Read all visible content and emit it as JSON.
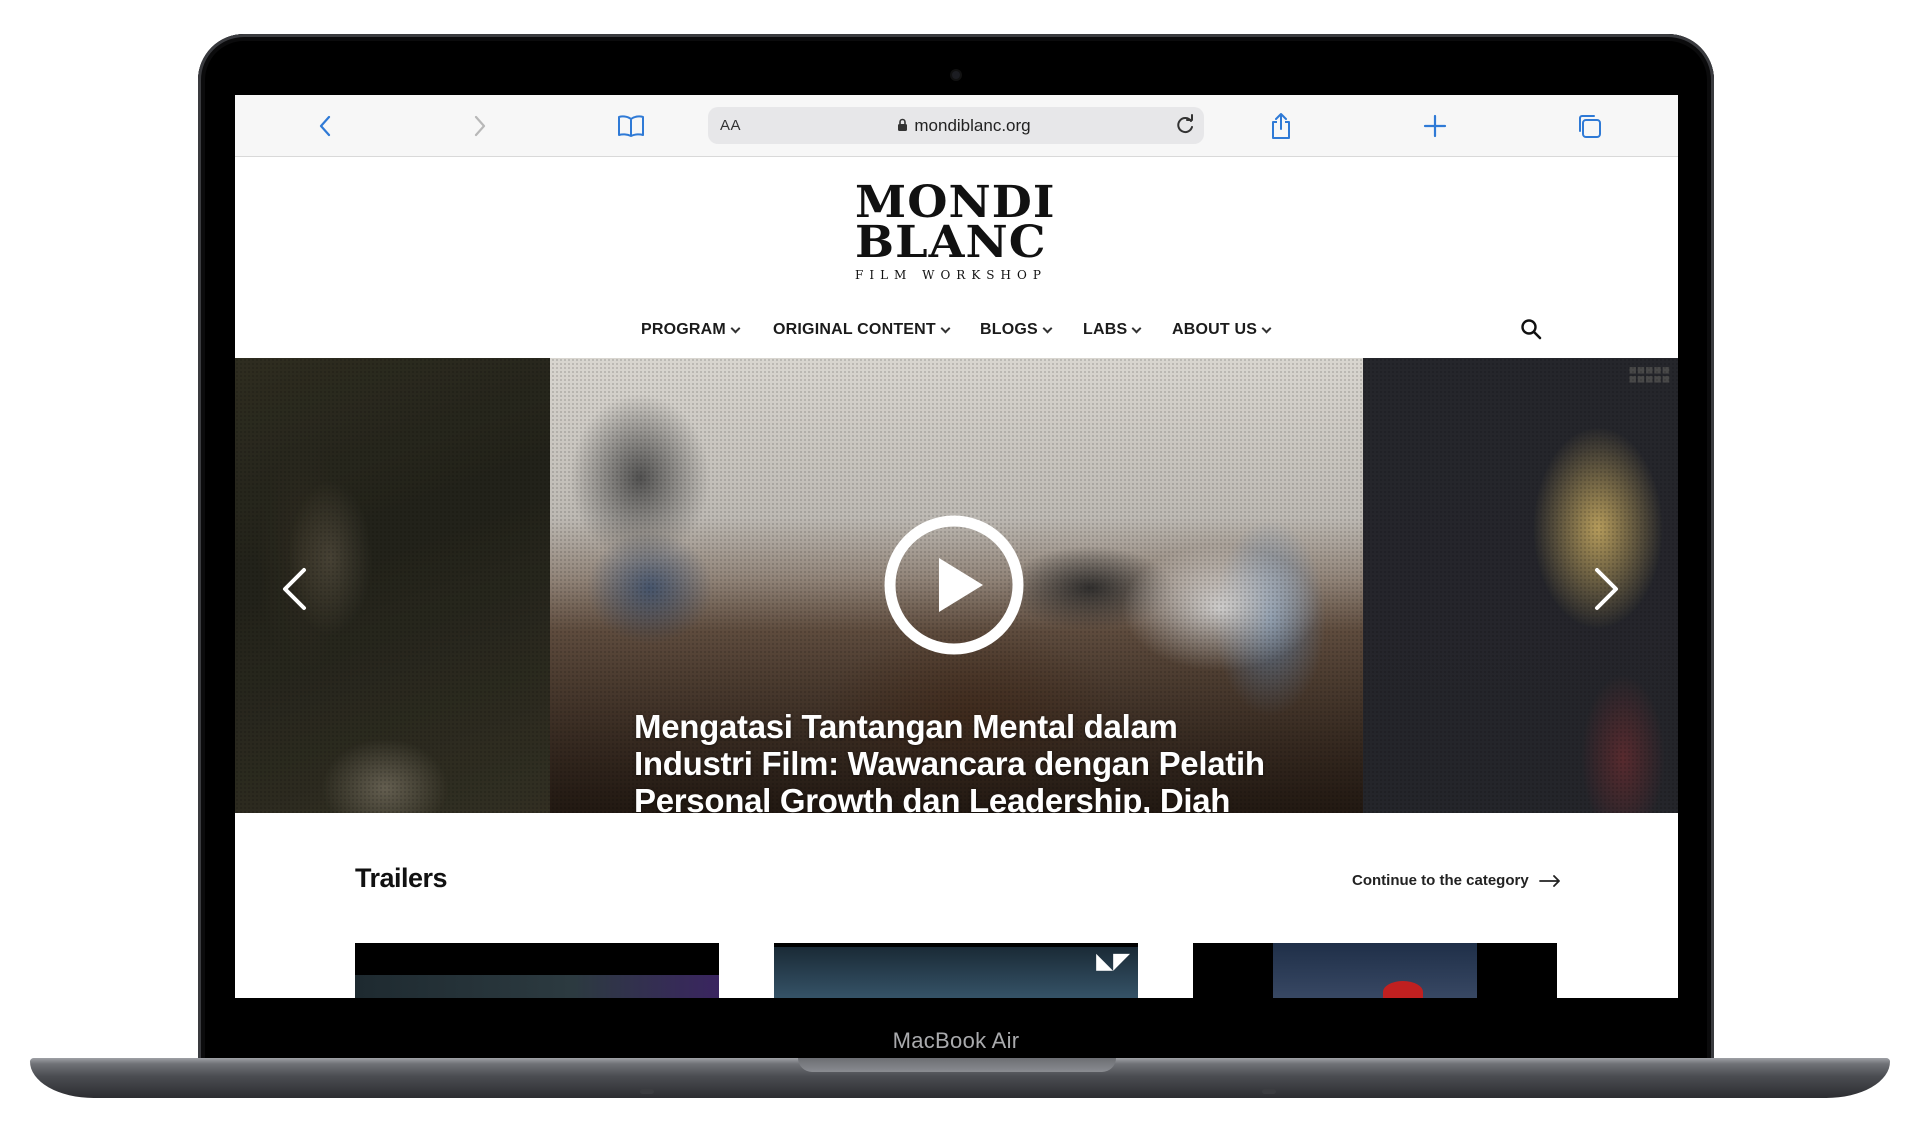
{
  "device": {
    "label": "MacBook Air"
  },
  "browser": {
    "text_size_label": "AA",
    "url": "mondiblanc.org"
  },
  "site": {
    "logo_line1": "MONDI",
    "logo_line2": "BLANC",
    "logo_sub": "FILM WORKSHOP",
    "brand_accent": "#0a6ac0",
    "nav": [
      {
        "label": "PROGRAM"
      },
      {
        "label": "ORIGINAL CONTENT"
      },
      {
        "label": "BLOGS"
      },
      {
        "label": "LABS"
      },
      {
        "label": "ABOUT US"
      }
    ]
  },
  "hero": {
    "title": "Mengatasi Tantangan Mental dalam Industri Film: Wawancara dengan Pelatih Personal Growth dan Leadership, Diah"
  },
  "trailers": {
    "heading": "Trailers",
    "continue_label": "Continue to the category"
  }
}
